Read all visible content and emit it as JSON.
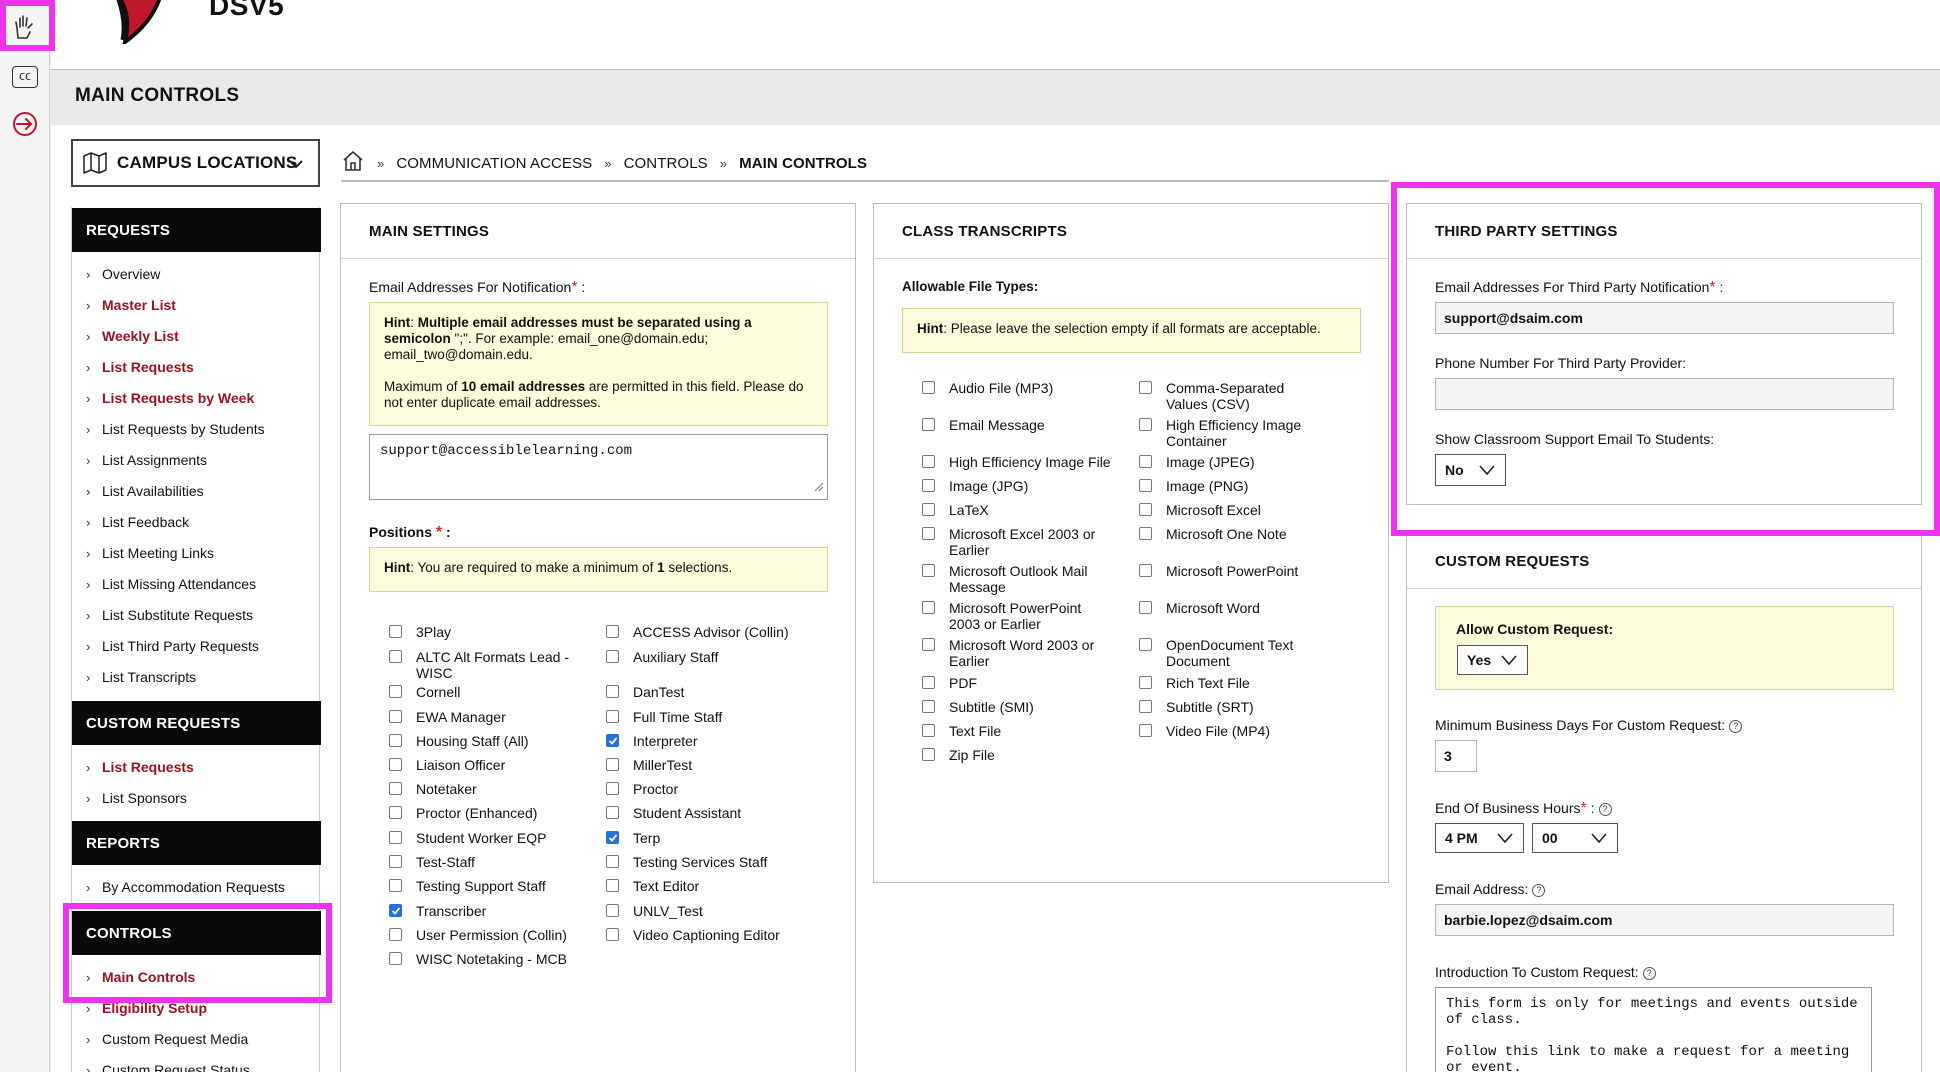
{
  "app": {
    "brand": "DSV5",
    "page_title": "MAIN CONTROLS"
  },
  "rail": {
    "icons": [
      "sign-language-icon",
      "closed-caption-icon",
      "logout-icon"
    ],
    "cc_label": "CC"
  },
  "campus": {
    "label": "CAMPUS LOCATIONS"
  },
  "breadcrumb": {
    "items": [
      "COMMUNICATION ACCESS",
      "CONTROLS",
      "MAIN CONTROLS"
    ]
  },
  "sidebar": {
    "requests": {
      "title": "REQUESTS",
      "items": [
        "Overview",
        "Master List",
        "Weekly List",
        "List Requests",
        "List Requests by Week",
        "List Requests by Students",
        "List Assignments",
        "List Availabilities",
        "List Feedback",
        "List Meeting Links",
        "List Missing Attendances",
        "List Substitute Requests",
        "List Third Party Requests",
        "List Transcripts"
      ]
    },
    "custom_requests": {
      "title": "CUSTOM REQUESTS",
      "items": [
        "List Requests",
        "List Sponsors"
      ]
    },
    "reports": {
      "title": "REPORTS",
      "items": [
        "By Accommodation Requests"
      ]
    },
    "controls": {
      "title": "CONTROLS",
      "items": [
        "Main Controls",
        "Eligibility Setup",
        "Custom Request Media",
        "Custom Request Status"
      ]
    }
  },
  "main_settings": {
    "title": "MAIN SETTINGS",
    "email_label": "Email Addresses For Notification",
    "hint_lead": "Hint",
    "hint_line1_a": ": ",
    "hint_line1_b": "Multiple email addresses must be separated using a semicolon",
    "hint_line1_c": " \";\". For example: email_one@domain.edu; email_two@domain.edu.",
    "hint_line2_a": "Maximum of ",
    "hint_line2_b": "10 email addresses",
    "hint_line2_c": " are permitted in this field. Please do not enter duplicate email addresses.",
    "email_value": "support@accessiblelearning.com",
    "positions_label": "Positions",
    "positions_hint_a": ": You are required to make a minimum of ",
    "positions_hint_b": "1",
    "positions_hint_c": " selections.",
    "positions": [
      {
        "label": "3Play",
        "checked": false
      },
      {
        "label": "ACCESS Advisor (Collin)",
        "checked": false
      },
      {
        "label": "ALTC Alt Formats Lead - WISC",
        "checked": false
      },
      {
        "label": "Auxiliary Staff",
        "checked": false
      },
      {
        "label": "Cornell",
        "checked": false
      },
      {
        "label": "DanTest",
        "checked": false
      },
      {
        "label": "EWA Manager",
        "checked": false
      },
      {
        "label": "Full Time Staff",
        "checked": false
      },
      {
        "label": "Housing Staff (All)",
        "checked": false
      },
      {
        "label": "Interpreter",
        "checked": true
      },
      {
        "label": "Liaison Officer",
        "checked": false
      },
      {
        "label": "MillerTest",
        "checked": false
      },
      {
        "label": "Notetaker",
        "checked": false
      },
      {
        "label": "Proctor",
        "checked": false
      },
      {
        "label": "Proctor (Enhanced)",
        "checked": false
      },
      {
        "label": "Student Assistant",
        "checked": false
      },
      {
        "label": "Student Worker EQP",
        "checked": false
      },
      {
        "label": "Terp",
        "checked": true
      },
      {
        "label": "Test-Staff",
        "checked": false
      },
      {
        "label": "Testing Services Staff",
        "checked": false
      },
      {
        "label": "Testing Support Staff",
        "checked": false
      },
      {
        "label": "Text Editor",
        "checked": false
      },
      {
        "label": "Transcriber",
        "checked": true
      },
      {
        "label": "UNLV_Test",
        "checked": false
      },
      {
        "label": "User Permission (Collin)",
        "checked": false
      },
      {
        "label": "Video Captioning Editor",
        "checked": false
      },
      {
        "label": "WISC Notetaking - MCB",
        "checked": false
      }
    ]
  },
  "class_transcripts": {
    "title": "CLASS TRANSCRIPTS",
    "file_types_label": "Allowable File Types:",
    "hint_lead": "Hint",
    "hint_text": ": Please leave the selection empty if all formats are acceptable.",
    "file_types": [
      "Audio File (MP3)",
      "Comma-Separated Values (CSV)",
      "Email Message",
      "High Efficiency Image Container",
      "High Efficiency Image File",
      "Image (JPEG)",
      "Image (JPG)",
      "Image (PNG)",
      "LaTeX",
      "Microsoft Excel",
      "Microsoft Excel 2003 or Earlier",
      "Microsoft One Note",
      "Microsoft Outlook Mail Message",
      "Microsoft PowerPoint",
      "Microsoft PowerPoint 2003 or Earlier",
      "Microsoft Word",
      "Microsoft Word 2003 or Earlier",
      "OpenDocument Text Document",
      "PDF",
      "Rich Text File",
      "Subtitle (SMI)",
      "Subtitle (SRT)",
      "Text File",
      "Video File (MP4)",
      "Zip File"
    ]
  },
  "third_party": {
    "title": "THIRD PARTY SETTINGS",
    "email_label": "Email Addresses For Third Party Notification",
    "email_value": "support@dsaim.com",
    "phone_label": "Phone Number For Third Party Provider:",
    "phone_value": "",
    "show_email_label": "Show Classroom Support Email To Students:",
    "show_email_value": "No"
  },
  "custom_requests_panel": {
    "title": "CUSTOM REQUESTS",
    "allow_label": "Allow Custom Request:",
    "allow_value": "Yes",
    "min_days_label": "Minimum Business Days For Custom Request:",
    "min_days_value": "3",
    "end_hours_label": "End Of Business Hours",
    "end_hour_value": "4 PM",
    "end_minute_value": "00",
    "email_label": "Email Address:",
    "email_value": "barbie.lopez@dsaim.com",
    "intro_label": "Introduction To Custom Request:",
    "intro_text": "This form is only for meetings and events outside of class.\n\nFollow this link to make a request for a meeting or event."
  },
  "colors": {
    "highlight": "#ee33ee",
    "accent_red": "#a01020",
    "required": "#e0202c",
    "hint_bg": "#fcfbdc",
    "checkbox_on": "#2670d9"
  }
}
